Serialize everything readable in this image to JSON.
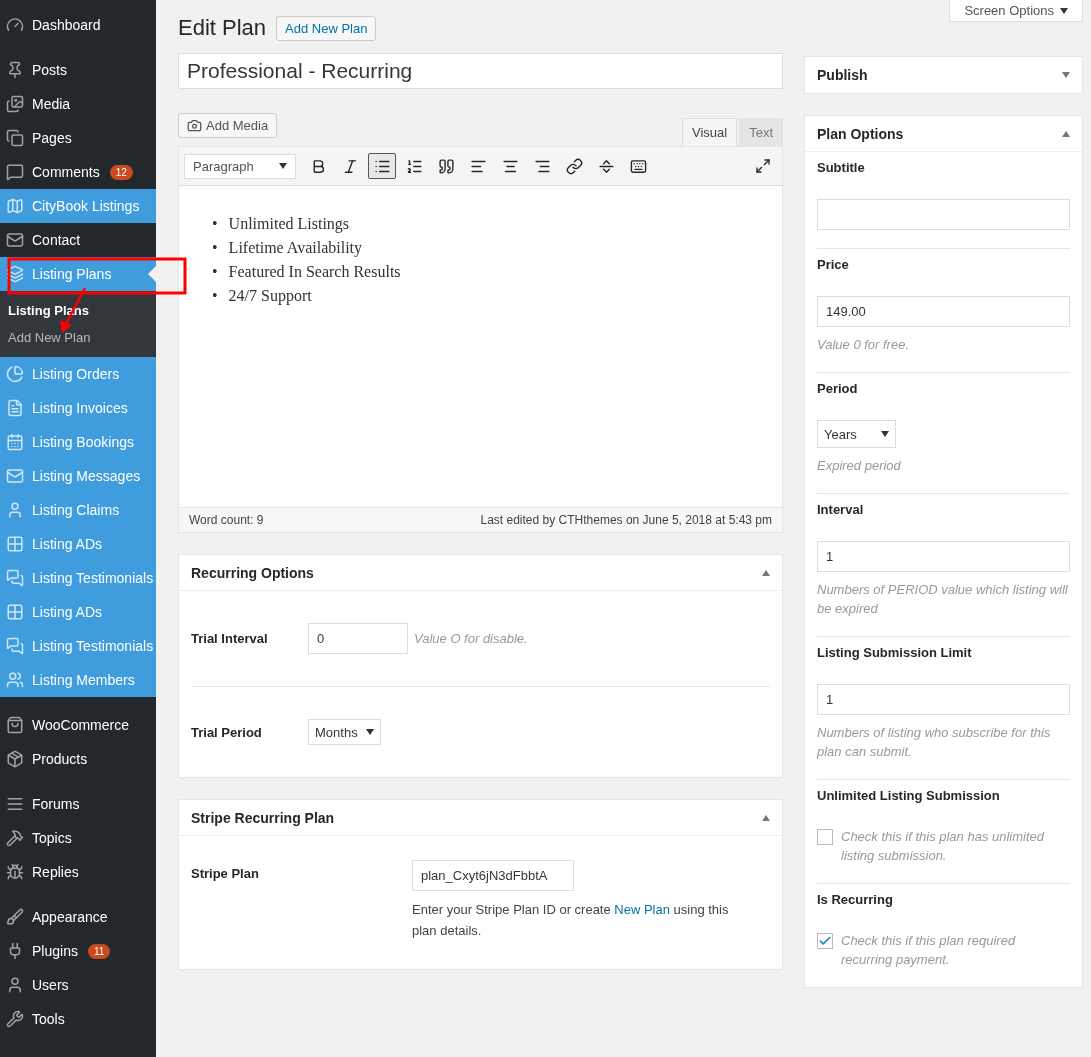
{
  "sidebar": {
    "groups": [
      [
        {
          "label": "Dashboard",
          "highlighted": false,
          "current": false
        }
      ],
      [
        {
          "label": "Posts",
          "highlighted": false,
          "current": false
        },
        {
          "label": "Media",
          "highlighted": false,
          "current": false
        },
        {
          "label": "Pages",
          "highlighted": false,
          "current": false
        },
        {
          "label": "Comments",
          "highlighted": false,
          "current": false,
          "badge": "12"
        },
        {
          "label": "CityBook Listings",
          "highlighted": true,
          "current": false
        },
        {
          "label": "Contact",
          "highlighted": false,
          "current": false
        },
        {
          "label": "Listing Plans",
          "highlighted": true,
          "current": true,
          "children": [
            {
              "label": "Listing Plans",
              "selected": true
            },
            {
              "label": "Add New Plan",
              "selected": false
            }
          ]
        },
        {
          "label": "Listing Orders",
          "highlighted": true,
          "current": false
        },
        {
          "label": "Listing Invoices",
          "highlighted": true,
          "current": false
        },
        {
          "label": "Listing Bookings",
          "highlighted": true,
          "current": false
        },
        {
          "label": "Listing Messages",
          "highlighted": true,
          "current": false
        },
        {
          "label": "Listing Claims",
          "highlighted": true,
          "current": false
        },
        {
          "label": "Listing ADs",
          "highlighted": true,
          "current": false
        },
        {
          "label": "Listing Testimonials",
          "highlighted": true,
          "current": false
        },
        {
          "label": "Listing ADs",
          "highlighted": true,
          "current": false
        },
        {
          "label": "Listing Testimonials",
          "highlighted": true,
          "current": false
        },
        {
          "label": "Listing Members",
          "highlighted": true,
          "current": false
        }
      ],
      [
        {
          "label": "WooCommerce",
          "highlighted": false,
          "current": false
        },
        {
          "label": "Products",
          "highlighted": false,
          "current": false
        }
      ],
      [
        {
          "label": "Forums",
          "highlighted": false,
          "current": false
        },
        {
          "label": "Topics",
          "highlighted": false,
          "current": false
        },
        {
          "label": "Replies",
          "highlighted": false,
          "current": false
        }
      ],
      [
        {
          "label": "Appearance",
          "highlighted": false,
          "current": false
        },
        {
          "label": "Plugins",
          "highlighted": false,
          "current": false,
          "badge": "11"
        },
        {
          "label": "Users",
          "highlighted": false,
          "current": false
        },
        {
          "label": "Tools",
          "highlighted": false,
          "current": false
        }
      ]
    ]
  },
  "header": {
    "title": "Edit Plan",
    "button": "Add New Plan",
    "screen_options": "Screen Options"
  },
  "post_title": "Professional - Recurring",
  "editor": {
    "add_media": "Add Media",
    "tabs": [
      {
        "label": "Visual",
        "selected": true
      },
      {
        "label": "Text",
        "selected": false
      }
    ],
    "format": "Paragraph",
    "toolbar": [
      {
        "active": false
      },
      {
        "active": false
      },
      {
        "active": true
      },
      {
        "active": false
      },
      {
        "active": false
      },
      {
        "active": false
      },
      {
        "active": false
      },
      {
        "active": false
      },
      {
        "active": false
      },
      {
        "active": false
      },
      {
        "active": false
      }
    ],
    "content": [
      {
        "marker": "•",
        "text": "Unlimited Listings"
      },
      {
        "marker": "•",
        "text": "Lifetime Availability"
      },
      {
        "marker": "•",
        "text": "Featured In Search Results"
      },
      {
        "marker": "•",
        "text": "24/7 Support"
      }
    ],
    "word_count": "Word count: 9",
    "last_edited": "Last edited by CTHthemes on June 5, 2018 at 5:43 pm"
  },
  "recurring_options": {
    "title": "Recurring Options",
    "expanded": true,
    "fields": [
      {
        "kind": "text",
        "label": "Trial Interval",
        "value": "0",
        "hint": "Value O for disable."
      },
      {
        "kind": "select",
        "label": "Trial Period",
        "value": "Months"
      }
    ]
  },
  "stripe": {
    "title": "Stripe Recurring Plan",
    "expanded": true,
    "label": "Stripe Plan",
    "value": "plan_Cxyt6jN3dFbbtA",
    "description_before": "Enter your Stripe Plan ID or create ",
    "link": "New Plan",
    "description_after": " using this plan details."
  },
  "publish": {
    "title": "Publish",
    "expanded": false
  },
  "plan_options": {
    "title": "Plan Options",
    "expanded": true,
    "fields": [
      {
        "kind": "text",
        "label": "Subtitle"
      },
      {
        "kind": "text",
        "label": "Price",
        "value": "149.00",
        "hint": "Value 0 for free."
      },
      {
        "kind": "select",
        "label": "Period",
        "value": "Years",
        "hint": "Expired period"
      },
      {
        "kind": "text",
        "label": "Interval",
        "value": "1",
        "hint": "Numbers of PERIOD value which listing will be expired"
      },
      {
        "kind": "text",
        "label": "Listing Submission Limit",
        "value": "1",
        "hint": "Numbers of listing who subscribe for this plan can submit."
      },
      {
        "kind": "checkbox",
        "label": "Unlimited Listing Submission",
        "checked": false,
        "hint": "Check this if this plan has unlimited listing submission."
      },
      {
        "kind": "checkbox",
        "label": "Is Recurring",
        "checked": true,
        "hint": "Check this if this plan required recurring payment."
      }
    ]
  }
}
